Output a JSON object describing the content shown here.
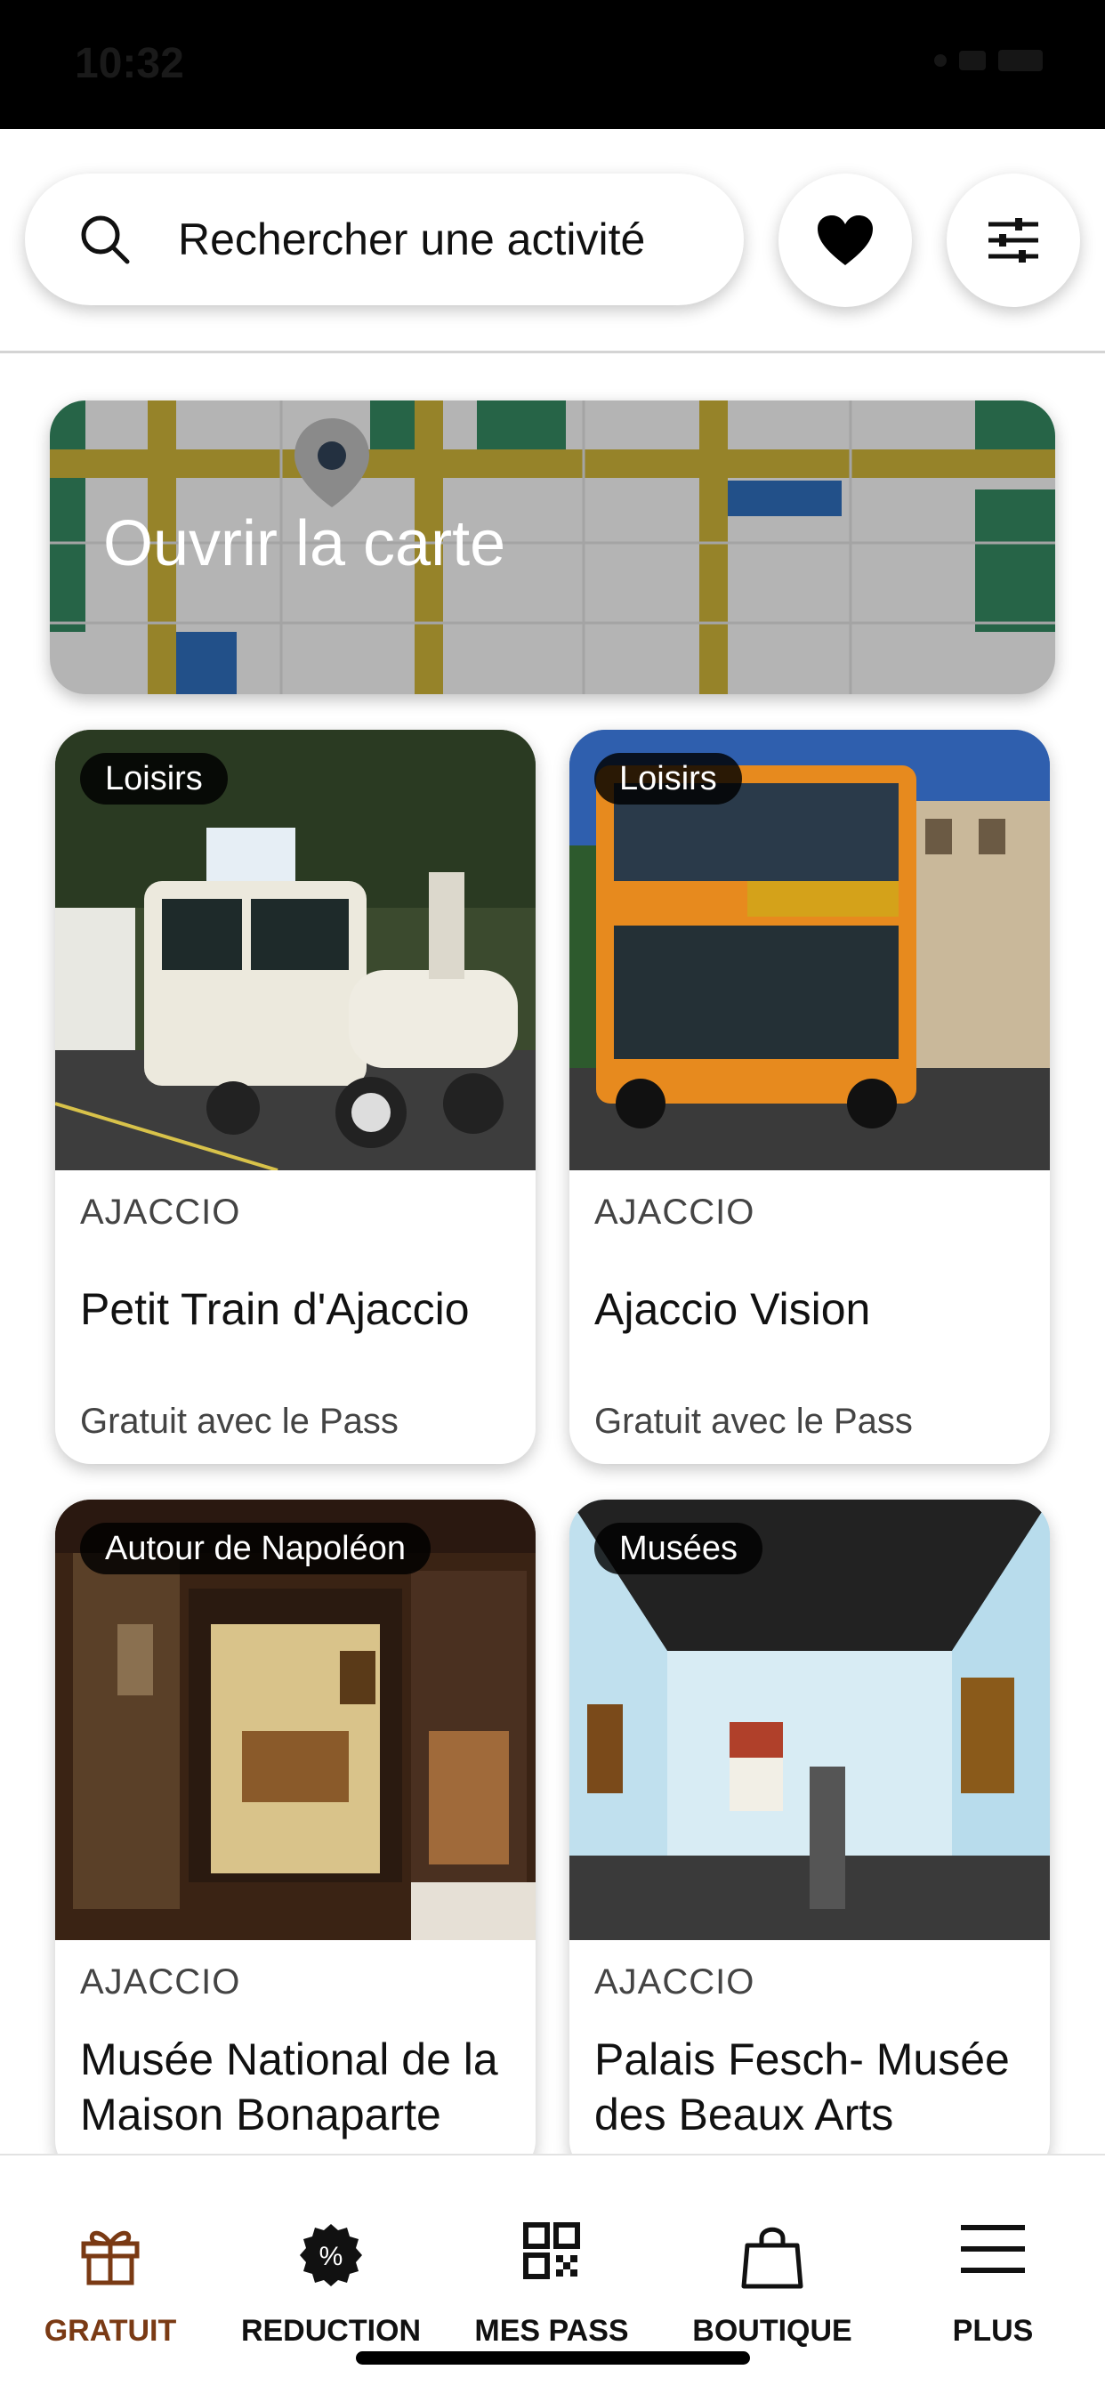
{
  "status_bar": {
    "time": "10:32"
  },
  "search": {
    "placeholder": "Rechercher une activité"
  },
  "icons": {
    "search": "search-icon",
    "favorites": "heart-icon",
    "filters": "sliders-icon"
  },
  "map": {
    "label": "Ouvrir la carte"
  },
  "cards": [
    {
      "category": "Loisirs",
      "city": "AJACCIO",
      "title": "Petit Train d'Ajaccio",
      "price": "Gratuit avec le Pass"
    },
    {
      "category": "Loisirs",
      "city": "AJACCIO",
      "title": "Ajaccio Vision",
      "price": "Gratuit avec le Pass"
    },
    {
      "category": "Autour de Napoléon",
      "city": "AJACCIO",
      "title": "Musée National de la Maison Bonaparte",
      "price": ""
    },
    {
      "category": "Musées",
      "city": "AJACCIO",
      "title": "Palais Fesch- Musée des Beaux Arts",
      "price": ""
    }
  ],
  "tabs": [
    {
      "label": "GRATUIT",
      "icon": "gift-icon",
      "active": true
    },
    {
      "label": "REDUCTION",
      "icon": "discount-badge-icon",
      "active": false
    },
    {
      "label": "MES PASS",
      "icon": "qr-code-icon",
      "active": false
    },
    {
      "label": "BOUTIQUE",
      "icon": "shopping-bag-icon",
      "active": false
    },
    {
      "label": "PLUS",
      "icon": "menu-icon",
      "active": false
    }
  ],
  "colors": {
    "active_tab": "#7a3a14",
    "map_road": "#b8a033",
    "map_park": "#2f7a57",
    "map_water": "#2a62a8"
  }
}
